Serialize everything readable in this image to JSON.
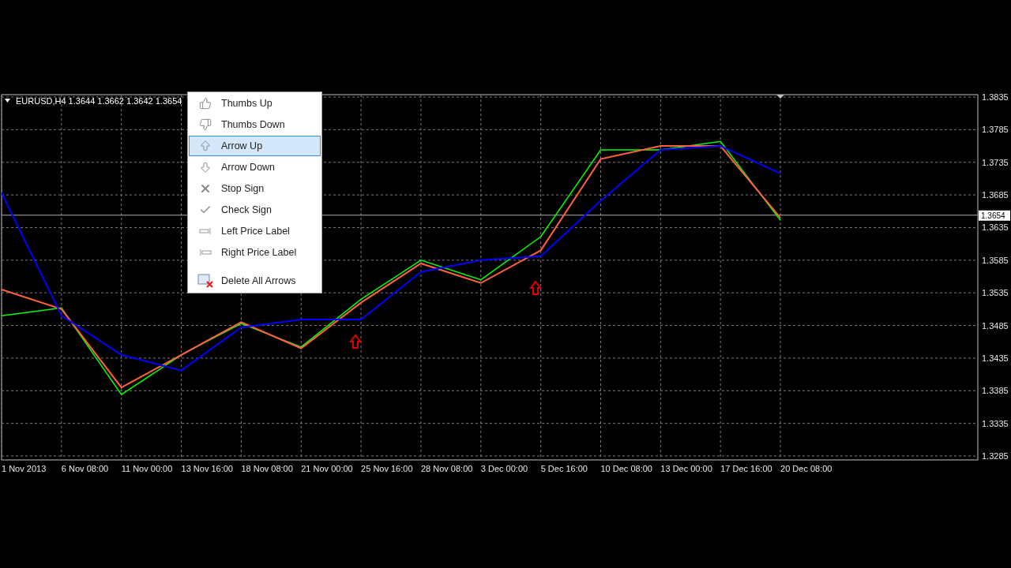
{
  "chart": {
    "header": "EURUSD,H4  1.3644 1.3662 1.3642 1.3654",
    "chart_data": {
      "type": "line",
      "grid": true,
      "ref_lines": [
        {
          "axis": "y",
          "value": 1.3654,
          "label": "1.3654"
        }
      ],
      "categories": [
        "1 Nov 2013",
        "6 Nov 08:00",
        "11 Nov 00:00",
        "13 Nov 16:00",
        "18 Nov 08:00",
        "21 Nov 00:00",
        "25 Nov 16:00",
        "28 Nov 08:00",
        "3 Dec 00:00",
        "5 Dec 16:00",
        "10 Dec 08:00",
        "13 Dec 00:00",
        "17 Dec 16:00",
        "20 Dec 08:00"
      ],
      "ylim": [
        1.3285,
        1.3835
      ],
      "yticks": [
        1.3285,
        1.3335,
        1.3385,
        1.3435,
        1.3485,
        1.3535,
        1.3585,
        1.3635,
        1.3685,
        1.3735,
        1.3785,
        1.3835
      ],
      "series": [
        {
          "color": "#00ff00",
          "values": [
            1.35,
            1.3512,
            1.3379,
            1.344,
            1.3488,
            1.3452,
            1.3525,
            1.3585,
            1.3555,
            1.3621,
            1.3754,
            1.3754,
            1.3767,
            1.3646
          ]
        },
        {
          "color": "#ff6040",
          "values": [
            1.354,
            1.351,
            1.339,
            1.344,
            1.349,
            1.345,
            1.352,
            1.358,
            1.355,
            1.36,
            1.374,
            1.376,
            1.376,
            1.365
          ]
        },
        {
          "color": "#0000ff",
          "values": [
            1.3688,
            1.35,
            1.344,
            1.3416,
            1.3482,
            1.3494,
            1.3494,
            1.3567,
            1.3585,
            1.3591,
            1.3676,
            1.3754,
            1.376,
            1.3718
          ]
        }
      ]
    }
  },
  "menu": {
    "sections": [
      [
        {
          "label": "Thumbs Up",
          "kind": "thumbs-up",
          "selected": false
        },
        {
          "label": "Thumbs Down",
          "kind": "thumbs-down",
          "selected": false
        },
        {
          "label": "Arrow Up",
          "kind": "arrow-up",
          "selected": true
        },
        {
          "label": "Arrow Down",
          "kind": "arrow-down",
          "selected": false
        },
        {
          "label": "Stop Sign",
          "kind": "stop",
          "selected": false
        },
        {
          "label": "Check Sign",
          "kind": "check",
          "selected": false
        },
        {
          "label": "Left Price Label",
          "kind": "left-price",
          "selected": false
        },
        {
          "label": "Right Price Label",
          "kind": "right-price",
          "selected": false
        }
      ],
      [
        {
          "label": "Delete All Arrows",
          "kind": "delete",
          "selected": false
        }
      ]
    ]
  }
}
